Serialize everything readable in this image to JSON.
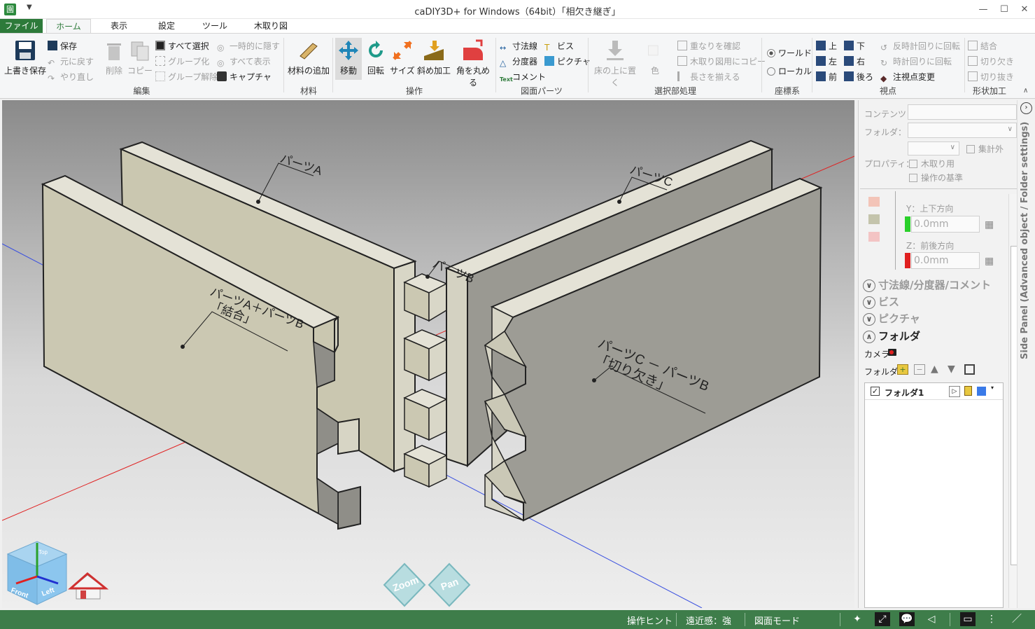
{
  "window": {
    "title": "caDIY3D+ for Windows（64bit）「相欠き継ぎ」",
    "app_icon": "園",
    "minimize": "—",
    "maximize": "☐",
    "close": "✕"
  },
  "tabs": [
    "ファイル",
    "ホーム",
    "表示",
    "設定",
    "ツール",
    "木取り図"
  ],
  "ribbon": {
    "edit": {
      "label": "編集",
      "overwrite_save": "上書き保存",
      "save": "保存",
      "undo": "元に戻す",
      "redo": "やり直し",
      "delete": "削除",
      "copy": "コピー",
      "select_all": "すべて選択",
      "group": "グループ化",
      "ungroup": "グループ解除",
      "hide_temp": "一時的に隠す",
      "show_all": "すべて表示",
      "capture": "キャプチャ"
    },
    "material": {
      "label": "材料",
      "add": "材料の追加"
    },
    "operation": {
      "label": "操作",
      "move": "移動",
      "rotate": "回転",
      "size": "サイズ",
      "bevel": "斜め加工",
      "round": "角を丸める"
    },
    "drawing_parts": {
      "label": "図面パーツ",
      "dimension": "寸法線",
      "screw": "ビス",
      "protractor": "分度器",
      "picture": "ピクチャ",
      "comment": "コメント",
      "comment_icon": "Text"
    },
    "selection": {
      "label": "選択部処理",
      "place_floor": "床の上に置く",
      "color": "色",
      "check_overlap": "重なりを確認",
      "copy_cutting": "木取り図用にコピー",
      "align_length": "長さを揃える"
    },
    "coords": {
      "label": "座標系",
      "world": "ワールド",
      "local": "ローカル"
    },
    "view": {
      "label": "視点",
      "top": "上",
      "bottom": "下",
      "left": "左",
      "right": "右",
      "front": "前",
      "back": "後ろ",
      "ccw": "反時計回りに回転",
      "cw": "時計回りに回転",
      "focus": "注視点変更"
    },
    "shape": {
      "label": "形状加工",
      "join": "結合",
      "notch": "切り欠き",
      "cut": "切り抜き"
    }
  },
  "viewport": {
    "annotations": {
      "part_a": "パーツA",
      "part_b": "パーツB",
      "part_c": "パーツC",
      "combine_line1": "パーツA＋パーツB",
      "combine_line2": "「結合」",
      "notch_line1": "パーツC － パーツB",
      "notch_line2": "「切り欠き」"
    },
    "navcube": {
      "front": "Front",
      "left": "Left",
      "top": "Top"
    },
    "zoom": "Zoom",
    "pan": "Pan"
  },
  "sidepanel": {
    "vertical_label": "Side Panel (Advanced object / Folder settings)",
    "contents_label": "コンテンツ：",
    "folder_label": "フォルダ：",
    "property_label": "プロパティ：",
    "aggregate_exclude": "集計外",
    "for_cutting": "木取り用",
    "op_reference": "操作の基準",
    "y_label": "Y：上下方向",
    "y_value": "0.0mm",
    "z_label": "Z：前後方向",
    "z_value": "0.0mm",
    "sections": {
      "dimension": "寸法線/分度器/コメント",
      "screw": "ビス",
      "picture": "ピクチャ",
      "folder": "フォルダ"
    },
    "camera_label": "カメラ",
    "folder_tools_label": "フォルダ",
    "folder_item": "フォルダ1"
  },
  "statusbar": {
    "hint": "操作ヒント",
    "perspective": "遠近感：強",
    "drawing_mode": "図面モード"
  },
  "colors": {
    "green": "#2d7a3a",
    "status": "#3e7d4a",
    "wood": "#c9c6ae",
    "wood_dark": "#8f8e88",
    "wood_side": "#e4e2d6"
  }
}
